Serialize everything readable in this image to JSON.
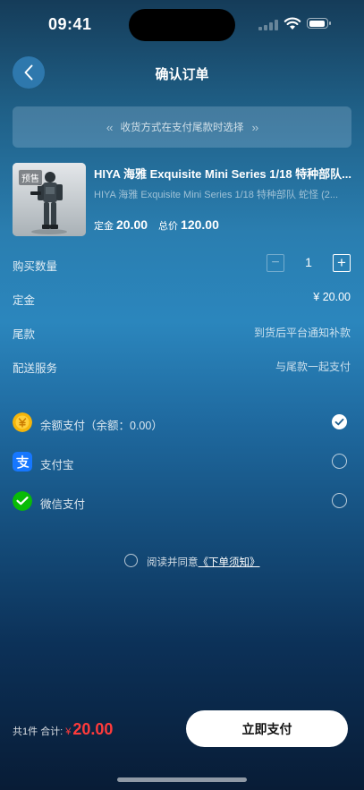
{
  "status_bar": {
    "time": "09:41"
  },
  "nav": {
    "title": "确认订单"
  },
  "notice": {
    "text": "收货方式在支付尾款时选择"
  },
  "product": {
    "badge": "预售",
    "title": "HIYA 海雅 Exquisite Mini Series 1/18 特种部队...",
    "subtitle": "HIYA 海雅 Exquisite Mini Series 1/18 特种部队 蛇怪 (2...",
    "deposit_label": "定金",
    "deposit_value": "20.00",
    "total_label": "总价",
    "total_value": "120.00"
  },
  "rows": {
    "quantity_label": "购买数量",
    "quantity_value": "1",
    "deposit_label": "定金",
    "deposit_value": "¥ 20.00",
    "balance_label": "尾款",
    "balance_value": "到货后平台通知补款",
    "delivery_label": "配送服务",
    "delivery_value": "与尾款一起支付"
  },
  "payment": {
    "options": [
      {
        "label": "余额支付（余额：0.00）",
        "icon": "balance-coin-icon",
        "selected": true
      },
      {
        "label": "支付宝",
        "icon": "alipay-icon",
        "selected": false
      },
      {
        "label": "微信支付",
        "icon": "wechat-pay-icon",
        "selected": false
      }
    ]
  },
  "agreement": {
    "prefix": "阅读并同意",
    "link": "《下单须知》"
  },
  "footer": {
    "count_label": "共1件",
    "sum_label": "合计:",
    "currency": "¥",
    "amount": "20.00",
    "pay_button": "立即支付"
  },
  "colors": {
    "accent_red": "#ff3b3b",
    "back_button": "#2e78ad",
    "alipay": "#1677ff",
    "wechat": "#09bb07",
    "coin": "#f5b50a"
  }
}
